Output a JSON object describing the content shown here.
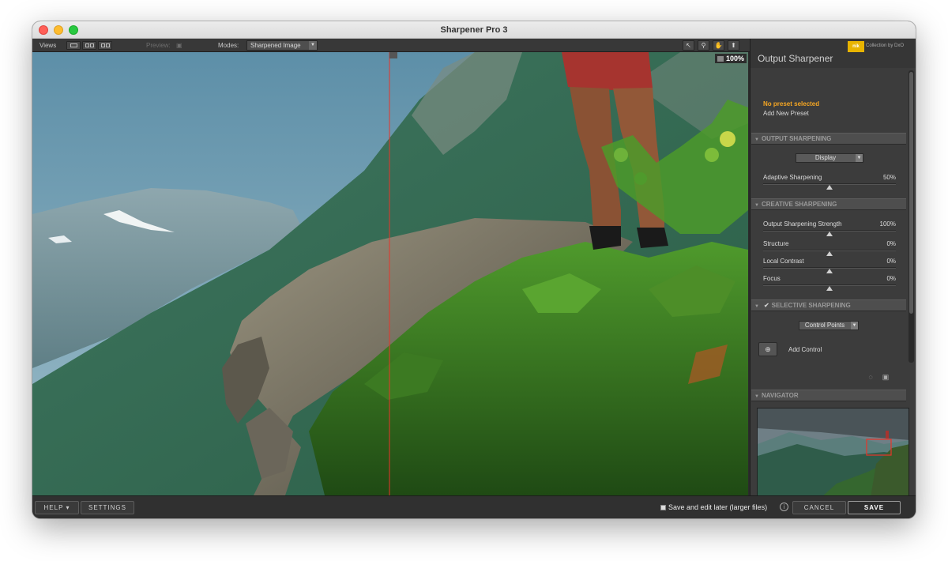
{
  "window": {
    "title": "Sharpener Pro 3"
  },
  "toolbar": {
    "views_label": "Views",
    "preview_label": "Preview:",
    "modes_label": "Modes:",
    "mode_value": "Sharpened Image",
    "zoom": "100%"
  },
  "sidebar": {
    "brand_logo": "nik",
    "brand_text": "Collection by DxO",
    "title": "Output Sharpener",
    "preset_status": "No preset selected",
    "add_preset": "Add New Preset",
    "sections": {
      "output": "OUTPUT SHARPENING",
      "creative": "CREATIVE SHARPENING",
      "selective": "SELECTIVE SHARPENING",
      "navigator": "NAVIGATOR"
    },
    "output_target": "Display",
    "adaptive": {
      "label": "Adaptive Sharpening",
      "value": "50%",
      "level": 0.5
    },
    "creative_sliders": [
      {
        "label": "Output Sharpening Strength",
        "value": "100%",
        "level": 0.5
      },
      {
        "label": "Structure",
        "value": "0%",
        "level": 0.5
      },
      {
        "label": "Local Contrast",
        "value": "0%",
        "level": 0.5
      },
      {
        "label": "Focus",
        "value": "0%",
        "level": 0.5
      }
    ],
    "selective_mode": "Control Points",
    "add_control": "Add Control"
  },
  "footer": {
    "help": "HELP ▾",
    "settings": "SETTINGS",
    "save_later": "Save and edit later (larger files)",
    "cancel": "CANCEL",
    "save": "SAVE"
  },
  "colors": {
    "preset_highlight": "#f5a623",
    "split_line": "#e8352a",
    "brand": "#e8b400"
  },
  "icons": [
    "single-view-icon",
    "split-view-icon",
    "side-by-side-icon",
    "preview-toggle-icon",
    "select-tool-icon",
    "zoom-tool-icon",
    "hand-tool-icon",
    "pin-tool-icon",
    "info-icon"
  ]
}
